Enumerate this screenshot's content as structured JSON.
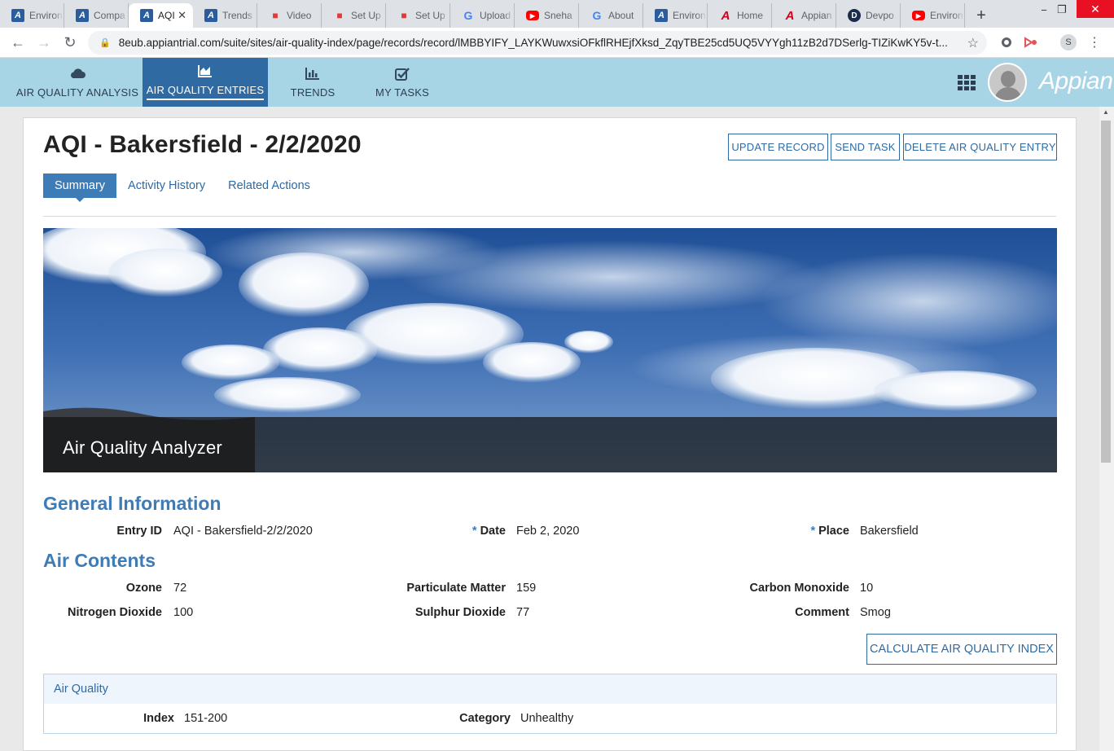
{
  "browser": {
    "tabs": [
      {
        "title": "Environ",
        "icon": "A",
        "kind": "appian"
      },
      {
        "title": "Compa",
        "icon": "A",
        "kind": "appian"
      },
      {
        "title": "AQI",
        "icon": "A",
        "kind": "appian",
        "active": true
      },
      {
        "title": "Trends",
        "icon": "A",
        "kind": "appian"
      },
      {
        "title": "Video",
        "icon": "■",
        "kind": "video"
      },
      {
        "title": "Set Up",
        "icon": "■",
        "kind": "video"
      },
      {
        "title": "Set Up",
        "icon": "■",
        "kind": "video"
      },
      {
        "title": "Upload",
        "icon": "G",
        "kind": "google"
      },
      {
        "title": "Sneha",
        "icon": "▶",
        "kind": "yt"
      },
      {
        "title": "About",
        "icon": "G",
        "kind": "google"
      },
      {
        "title": "Environ",
        "icon": "A",
        "kind": "appian"
      },
      {
        "title": "Home",
        "icon": "A",
        "kind": "appian2"
      },
      {
        "title": "Appian",
        "icon": "A",
        "kind": "appian2"
      },
      {
        "title": "Devpo",
        "icon": "D",
        "kind": "dev"
      },
      {
        "title": "Environ",
        "icon": "▶",
        "kind": "yt"
      }
    ],
    "new_tab": "+",
    "close_tab": "✕",
    "url": "8eub.appiantrial.com/suite/sites/air-quality-index/page/records/record/lMBBYIFY_LAYKWuwxsiOFkflRHEjfXksd_ZqyTBE25cd5UQ5VYYgh11zB2d7DSerlg-TIZiKwKY5v-t...",
    "profile_initial": "S",
    "icons": {
      "back": "←",
      "forward": "→",
      "reload": "↻",
      "lock": "🔒",
      "star": "☆",
      "minimize": "−",
      "restore": "❐",
      "close": "✕"
    }
  },
  "app": {
    "nav": [
      {
        "label": "AIR QUALITY ANALYSIS",
        "icon": "cloud-icon"
      },
      {
        "label": "AIR QUALITY ENTRIES",
        "icon": "area-chart-icon",
        "active": true
      },
      {
        "label": "TRENDS",
        "icon": "bar-chart-icon"
      },
      {
        "label": "MY TASKS",
        "icon": "check-square-icon"
      }
    ],
    "brand": "Appian"
  },
  "record": {
    "title": "AQI - Bakersfield - 2/2/2020",
    "actions": [
      "UPDATE RECORD",
      "SEND TASK",
      "DELETE AIR QUALITY ENTRY"
    ],
    "tabs": [
      "Summary",
      "Activity History",
      "Related Actions"
    ],
    "banner_caption": "Air Quality Analyzer",
    "general": {
      "heading": "General Information",
      "entry_id_label": "Entry ID",
      "entry_id": "AQI - Bakersfield-2/2/2020",
      "date_label": "Date",
      "date": "Feb 2, 2020",
      "place_label": "Place",
      "place": "Bakersfield",
      "required_mark": "*"
    },
    "contents": {
      "heading": "Air Contents",
      "ozone_label": "Ozone",
      "ozone": "72",
      "pm_label": "Particulate Matter",
      "pm": "159",
      "co_label": "Carbon Monoxide",
      "co": "10",
      "no2_label": "Nitrogen Dioxide",
      "no2": "100",
      "so2_label": "Sulphur Dioxide",
      "so2": "77",
      "comment_label": "Comment",
      "comment": "Smog"
    },
    "calculate_label": "CALCULATE AIR QUALITY INDEX",
    "air_quality": {
      "heading": "Air Quality",
      "index_label": "Index",
      "index": "151-200",
      "category_label": "Category",
      "category": "Unhealthy"
    }
  }
}
